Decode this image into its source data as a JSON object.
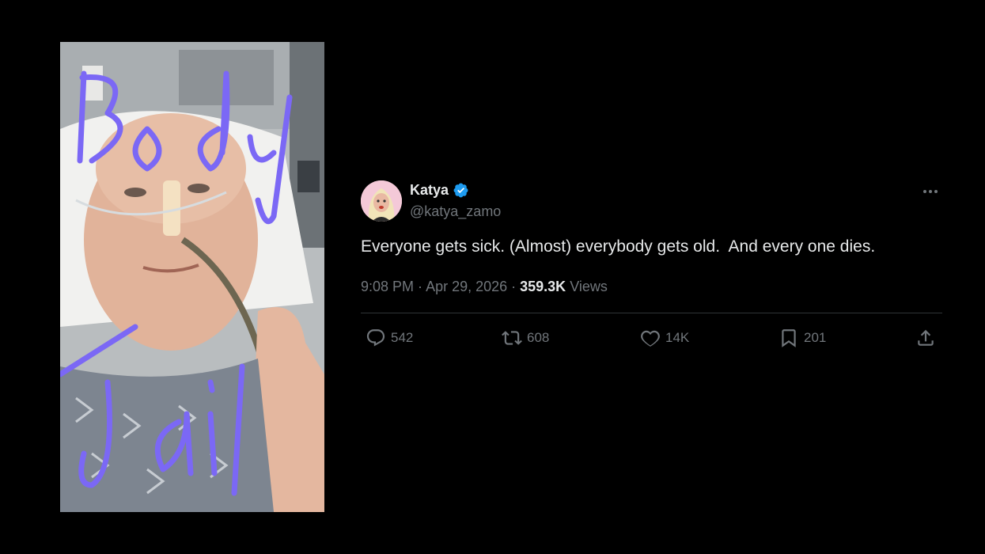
{
  "tweet": {
    "name": "Katya",
    "handle": "@katya_zamo",
    "text": "Everyone gets sick. (Almost) everybody gets old.  And every one dies.",
    "time": "9:08 PM",
    "date": "Apr 29, 2026",
    "views_count": "359.3K",
    "views_label": "Views",
    "actions": {
      "replies": "542",
      "reposts": "608",
      "likes": "14K",
      "bookmarks": "201"
    }
  },
  "photo": {
    "caption_top": "Body",
    "caption_bottom": "Jail"
  },
  "icons": [
    "verified-badge-icon",
    "more-icon",
    "reply-icon",
    "repost-icon",
    "like-icon",
    "bookmark-icon",
    "share-icon"
  ],
  "colors": {
    "background": "#000000",
    "text": "#e7e9ea",
    "muted": "#71767b",
    "verified": "#1d9bf0",
    "scribble": "#7b68f5"
  }
}
